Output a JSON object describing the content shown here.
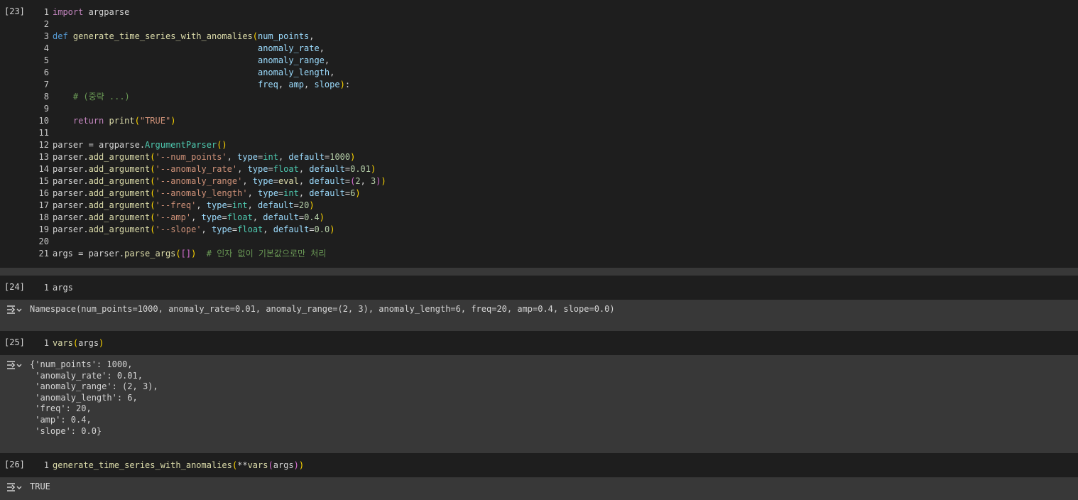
{
  "cells": [
    {
      "count": "[23]",
      "lines": [
        {
          "n": "1",
          "tokens": [
            [
              "kw-ctl",
              "import"
            ],
            [
              "txt",
              " argparse"
            ]
          ]
        },
        {
          "n": "2",
          "tokens": []
        },
        {
          "n": "3",
          "tokens": [
            [
              "kw",
              "def"
            ],
            [
              "txt",
              " "
            ],
            [
              "fn",
              "generate_time_series_with_anomalies"
            ],
            [
              "br1",
              "("
            ],
            [
              "var",
              "num_points"
            ],
            [
              "txt",
              ","
            ]
          ]
        },
        {
          "n": "4",
          "tokens": [
            [
              "txt",
              "                                        "
            ],
            [
              "var",
              "anomaly_rate"
            ],
            [
              "txt",
              ","
            ]
          ]
        },
        {
          "n": "5",
          "tokens": [
            [
              "txt",
              "                                        "
            ],
            [
              "var",
              "anomaly_range"
            ],
            [
              "txt",
              ","
            ]
          ]
        },
        {
          "n": "6",
          "tokens": [
            [
              "txt",
              "                                        "
            ],
            [
              "var",
              "anomaly_length"
            ],
            [
              "txt",
              ","
            ]
          ]
        },
        {
          "n": "7",
          "tokens": [
            [
              "txt",
              "                                        "
            ],
            [
              "var",
              "freq"
            ],
            [
              "txt",
              ", "
            ],
            [
              "var",
              "amp"
            ],
            [
              "txt",
              ", "
            ],
            [
              "var",
              "slope"
            ],
            [
              "br1",
              ")"
            ],
            [
              "txt",
              ":"
            ]
          ]
        },
        {
          "n": "8",
          "tokens": [
            [
              "txt",
              "    "
            ],
            [
              "com",
              "# (중략 ...)"
            ]
          ]
        },
        {
          "n": "9",
          "tokens": []
        },
        {
          "n": "10",
          "tokens": [
            [
              "txt",
              "    "
            ],
            [
              "kw-ctl",
              "return"
            ],
            [
              "txt",
              " "
            ],
            [
              "fn",
              "print"
            ],
            [
              "br1",
              "("
            ],
            [
              "str",
              "\"TRUE\""
            ],
            [
              "br1",
              ")"
            ]
          ]
        },
        {
          "n": "11",
          "tokens": []
        },
        {
          "n": "12",
          "tokens": [
            [
              "txt",
              "parser = argparse."
            ],
            [
              "type",
              "ArgumentParser"
            ],
            [
              "br1",
              "()"
            ]
          ]
        },
        {
          "n": "13",
          "tokens": [
            [
              "txt",
              "parser."
            ],
            [
              "fn",
              "add_argument"
            ],
            [
              "br1",
              "("
            ],
            [
              "str",
              "'--num_points'"
            ],
            [
              "txt",
              ", "
            ],
            [
              "var",
              "type"
            ],
            [
              "txt",
              "="
            ],
            [
              "type",
              "int"
            ],
            [
              "txt",
              ", "
            ],
            [
              "var",
              "default"
            ],
            [
              "txt",
              "="
            ],
            [
              "num",
              "1000"
            ],
            [
              "br1",
              ")"
            ]
          ]
        },
        {
          "n": "14",
          "tokens": [
            [
              "txt",
              "parser."
            ],
            [
              "fn",
              "add_argument"
            ],
            [
              "br1",
              "("
            ],
            [
              "str",
              "'--anomaly_rate'"
            ],
            [
              "txt",
              ", "
            ],
            [
              "var",
              "type"
            ],
            [
              "txt",
              "="
            ],
            [
              "type",
              "float"
            ],
            [
              "txt",
              ", "
            ],
            [
              "var",
              "default"
            ],
            [
              "txt",
              "="
            ],
            [
              "num",
              "0.01"
            ],
            [
              "br1",
              ")"
            ]
          ]
        },
        {
          "n": "15",
          "tokens": [
            [
              "txt",
              "parser."
            ],
            [
              "fn",
              "add_argument"
            ],
            [
              "br1",
              "("
            ],
            [
              "str",
              "'--anomaly_range'"
            ],
            [
              "txt",
              ", "
            ],
            [
              "var",
              "type"
            ],
            [
              "txt",
              "="
            ],
            [
              "fn",
              "eval"
            ],
            [
              "txt",
              ", "
            ],
            [
              "var",
              "default"
            ],
            [
              "txt",
              "="
            ],
            [
              "br2",
              "("
            ],
            [
              "num",
              "2"
            ],
            [
              "txt",
              ", "
            ],
            [
              "num",
              "3"
            ],
            [
              "br2",
              ")"
            ],
            [
              "br1",
              ")"
            ]
          ]
        },
        {
          "n": "16",
          "tokens": [
            [
              "txt",
              "parser."
            ],
            [
              "fn",
              "add_argument"
            ],
            [
              "br1",
              "("
            ],
            [
              "str",
              "'--anomaly_length'"
            ],
            [
              "txt",
              ", "
            ],
            [
              "var",
              "type"
            ],
            [
              "txt",
              "="
            ],
            [
              "type",
              "int"
            ],
            [
              "txt",
              ", "
            ],
            [
              "var",
              "default"
            ],
            [
              "txt",
              "="
            ],
            [
              "num",
              "6"
            ],
            [
              "br1",
              ")"
            ]
          ]
        },
        {
          "n": "17",
          "tokens": [
            [
              "txt",
              "parser."
            ],
            [
              "fn",
              "add_argument"
            ],
            [
              "br1",
              "("
            ],
            [
              "str",
              "'--freq'"
            ],
            [
              "txt",
              ", "
            ],
            [
              "var",
              "type"
            ],
            [
              "txt",
              "="
            ],
            [
              "type",
              "int"
            ],
            [
              "txt",
              ", "
            ],
            [
              "var",
              "default"
            ],
            [
              "txt",
              "="
            ],
            [
              "num",
              "20"
            ],
            [
              "br1",
              ")"
            ]
          ]
        },
        {
          "n": "18",
          "tokens": [
            [
              "txt",
              "parser."
            ],
            [
              "fn",
              "add_argument"
            ],
            [
              "br1",
              "("
            ],
            [
              "str",
              "'--amp'"
            ],
            [
              "txt",
              ", "
            ],
            [
              "var",
              "type"
            ],
            [
              "txt",
              "="
            ],
            [
              "type",
              "float"
            ],
            [
              "txt",
              ", "
            ],
            [
              "var",
              "default"
            ],
            [
              "txt",
              "="
            ],
            [
              "num",
              "0.4"
            ],
            [
              "br1",
              ")"
            ]
          ]
        },
        {
          "n": "19",
          "tokens": [
            [
              "txt",
              "parser."
            ],
            [
              "fn",
              "add_argument"
            ],
            [
              "br1",
              "("
            ],
            [
              "str",
              "'--slope'"
            ],
            [
              "txt",
              ", "
            ],
            [
              "var",
              "type"
            ],
            [
              "txt",
              "="
            ],
            [
              "type",
              "float"
            ],
            [
              "txt",
              ", "
            ],
            [
              "var",
              "default"
            ],
            [
              "txt",
              "="
            ],
            [
              "num",
              "0.0"
            ],
            [
              "br1",
              ")"
            ]
          ]
        },
        {
          "n": "20",
          "tokens": []
        },
        {
          "n": "21",
          "tokens": [
            [
              "txt",
              "args = parser."
            ],
            [
              "fn",
              "parse_args"
            ],
            [
              "br1",
              "("
            ],
            [
              "br2",
              "[]"
            ],
            [
              "br1",
              ")"
            ],
            [
              "txt",
              "  "
            ],
            [
              "com",
              "# 인자 없이 기본값으로만 처리"
            ]
          ]
        }
      ]
    },
    {
      "count": "[24]",
      "lines": [
        {
          "n": "1",
          "tokens": [
            [
              "txt",
              "args"
            ]
          ]
        }
      ],
      "output": "Namespace(num_points=1000, anomaly_rate=0.01, anomaly_range=(2, 3), anomaly_length=6, freq=20, amp=0.4, slope=0.0)"
    },
    {
      "count": "[25]",
      "lines": [
        {
          "n": "1",
          "tokens": [
            [
              "fn",
              "vars"
            ],
            [
              "br1",
              "("
            ],
            [
              "txt",
              "args"
            ],
            [
              "br1",
              ")"
            ]
          ]
        }
      ],
      "output": "{'num_points': 1000,\n 'anomaly_rate': 0.01,\n 'anomaly_range': (2, 3),\n 'anomaly_length': 6,\n 'freq': 20,\n 'amp': 0.4,\n 'slope': 0.0}"
    },
    {
      "count": "[26]",
      "lines": [
        {
          "n": "1",
          "tokens": [
            [
              "fn",
              "generate_time_series_with_anomalies"
            ],
            [
              "br1",
              "("
            ],
            [
              "txt",
              "**"
            ],
            [
              "fn",
              "vars"
            ],
            [
              "br2",
              "("
            ],
            [
              "txt",
              "args"
            ],
            [
              "br2",
              ")"
            ],
            [
              "br1",
              ")"
            ]
          ]
        }
      ],
      "output": "TRUE"
    }
  ],
  "icons": {
    "output_toggle": "output-toggle-icon"
  },
  "colors": {
    "cell_bg": "#1e1e1e",
    "output_bg": "#383838",
    "keyword": "#569cd6",
    "control": "#c586c0",
    "function": "#dcdcaa",
    "variable": "#9cdcfe",
    "string": "#ce9178",
    "number": "#b5cea8",
    "comment": "#6a9955",
    "bracket1": "#ffd700",
    "bracket2": "#da70d6",
    "type": "#4ec9b0"
  }
}
